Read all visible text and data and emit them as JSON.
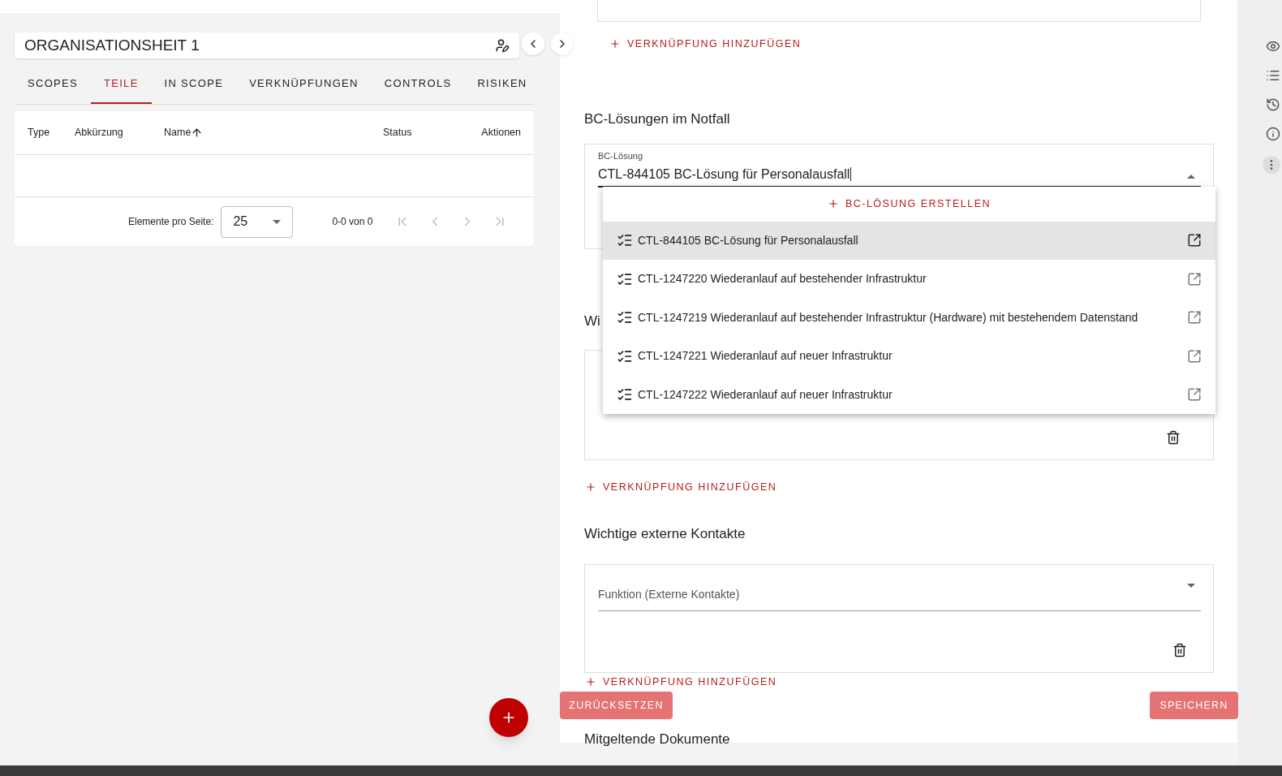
{
  "panel": {
    "title": "ORGANISATIONSHEIT 1"
  },
  "tabs": [
    {
      "label": "SCOPES",
      "selected": false
    },
    {
      "label": "TEILE",
      "selected": true
    },
    {
      "label": "IN SCOPE",
      "selected": false
    },
    {
      "label": "VERKNÜPFUNGEN",
      "selected": false
    },
    {
      "label": "CONTROLS",
      "selected": false
    },
    {
      "label": "RISIKEN",
      "selected": false
    }
  ],
  "table": {
    "columns": [
      {
        "label": "Type",
        "sorted": false
      },
      {
        "label": "Abkürzung",
        "sorted": false
      },
      {
        "label": "Name",
        "sorted": true
      },
      {
        "label": "Status",
        "sorted": false
      },
      {
        "label": "Aktionen",
        "sorted": false
      }
    ]
  },
  "pagination": {
    "label": "Elemente pro Seite:",
    "page_size": "25",
    "range": "0-0 von 0"
  },
  "form": {
    "top_link": "VERKNÜPFUNG HINZUFÜGEN",
    "bc_heading": "BC-Lösungen im Notfall",
    "bc_field": {
      "label": "BC-Lösung",
      "value": "CTL-844105 BC-Lösung für Personalausfall"
    },
    "dropdown": {
      "create": "BC-LÖSUNG ERSTELLEN",
      "options": [
        {
          "label": "CTL-844105 BC-Lösung für Personalausfall",
          "selected": true
        },
        {
          "label": "CTL-1247220 Wiederanlauf auf bestehender Infrastruktur",
          "selected": false
        },
        {
          "label": "CTL-1247219 Wiederanlauf auf bestehender Infrastruktur (Hardware) mit bestehendem Datenstand",
          "selected": false
        },
        {
          "label": "CTL-1247221 Wiederanlauf auf neuer Infrastruktur",
          "selected": false
        },
        {
          "label": "CTL-1247222 Wiederanlauf auf neuer Infrastruktur",
          "selected": false
        }
      ]
    },
    "hidden_heading": "Wi",
    "link_2": "VERKNÜPFUNG HINZUFÜGEN",
    "contacts_heading": "Wichtige externe Kontakte",
    "contacts_field": {
      "placeholder": "Funktion (Externe Kontakte)"
    },
    "link_3": "VERKNÜPFUNG HINZUFÜGEN",
    "docs_heading": "Mitgeltende Dokumente"
  },
  "buttons": {
    "reset": "ZURÜCKSETZEN",
    "save": "SPEICHERN"
  }
}
